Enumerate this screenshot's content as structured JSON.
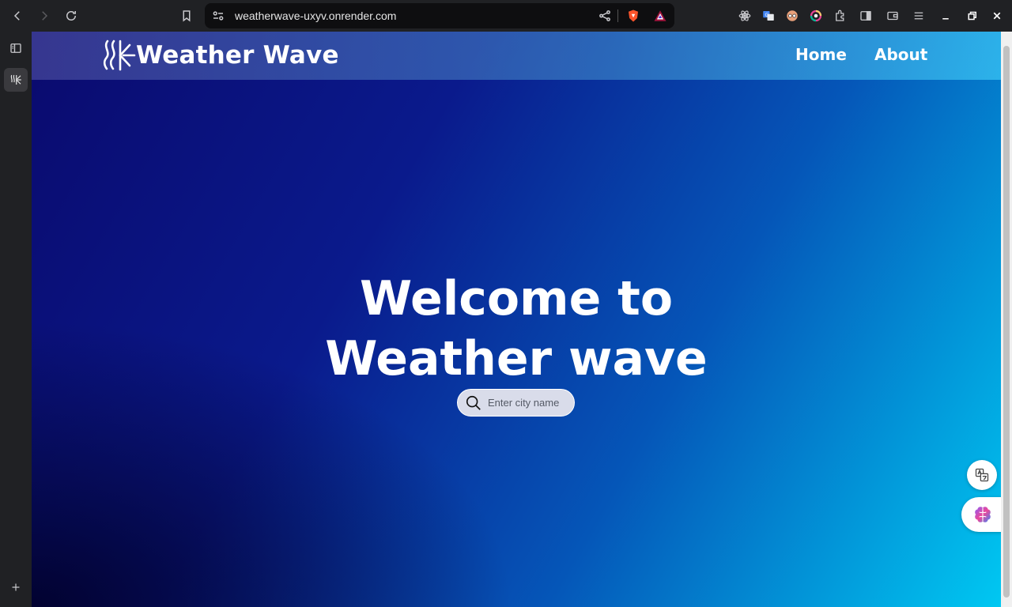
{
  "browser": {
    "url": "weatherwave-uxyv.onrender.com"
  },
  "site": {
    "brand": "Weather Wave",
    "nav": {
      "home": "Home",
      "about": "About"
    },
    "hero_line1": "Welcome to",
    "hero_line2": "Weather wave",
    "search": {
      "placeholder": "Enter city name"
    }
  }
}
